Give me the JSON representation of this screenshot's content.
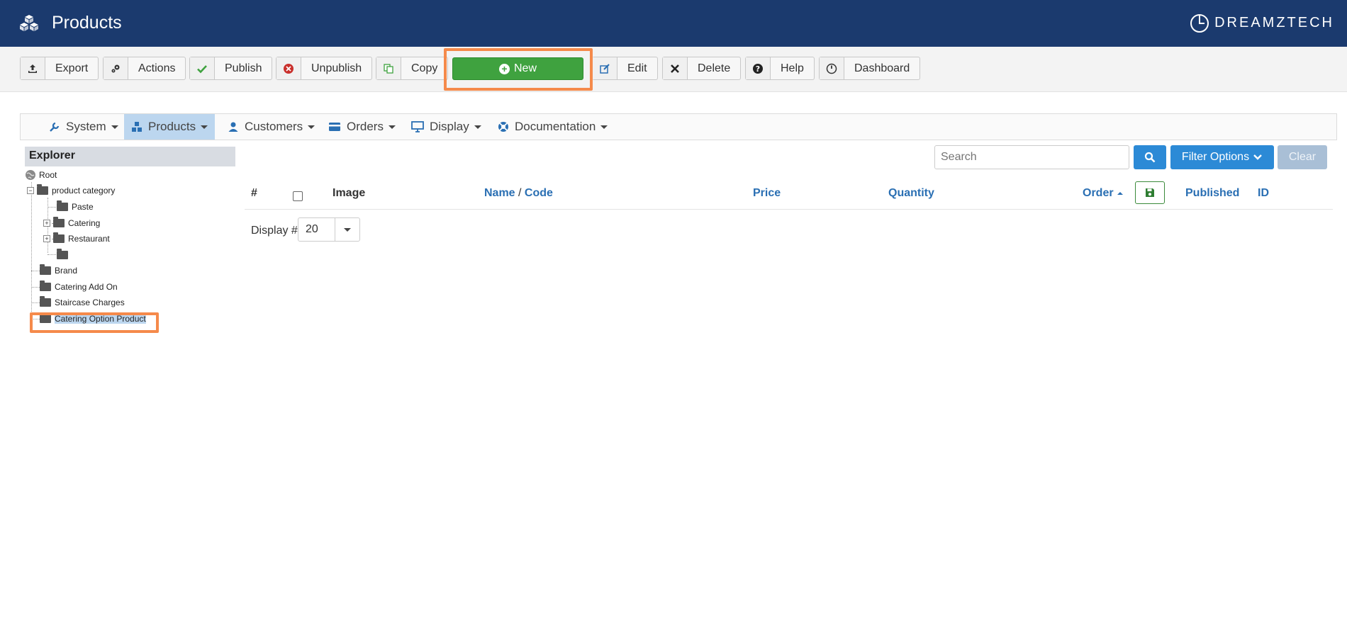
{
  "header": {
    "title": "Products",
    "brand": "DREAMZTECH",
    "bg_color": "#1b3a6e"
  },
  "toolbar": {
    "export": "Export",
    "actions": "Actions",
    "publish": "Publish",
    "unpublish": "Unpublish",
    "copy": "Copy",
    "new": "New",
    "edit": "Edit",
    "delete": "Delete",
    "help": "Help",
    "dashboard": "Dashboard"
  },
  "nav": {
    "items": [
      {
        "label": "System",
        "icon": "wrench-icon"
      },
      {
        "label": "Products",
        "icon": "cubes-icon"
      },
      {
        "label": "Customers",
        "icon": "user-icon"
      },
      {
        "label": "Orders",
        "icon": "credit-card-icon"
      },
      {
        "label": "Display",
        "icon": "monitor-icon"
      },
      {
        "label": "Documentation",
        "icon": "lifebuoy-icon"
      }
    ],
    "active": "Products"
  },
  "explorer": {
    "title": "Explorer",
    "nodes": {
      "root": "Root",
      "product_category": "product category",
      "paste": "Paste",
      "catering": "Catering",
      "restaurant": "Restaurant",
      "brand": "Brand",
      "catering_add_on": "Catering Add On",
      "staircase_charges": "Staircase Charges",
      "catering_option_product": "Catering Option Product"
    }
  },
  "search": {
    "placeholder": "Search",
    "filter_label": "Filter Options",
    "clear_label": "Clear"
  },
  "table": {
    "columns": {
      "num": "#",
      "image": "Image",
      "name": "Name",
      "sep": " / ",
      "code": "Code",
      "price": "Price",
      "quantity": "Quantity",
      "order": "Order",
      "published": "Published",
      "id": "ID"
    }
  },
  "display": {
    "label": "Display #",
    "value": "20"
  },
  "colors": {
    "primary": "#2c8ad6",
    "success": "#3fa23f",
    "highlight": "#f58a4b"
  }
}
